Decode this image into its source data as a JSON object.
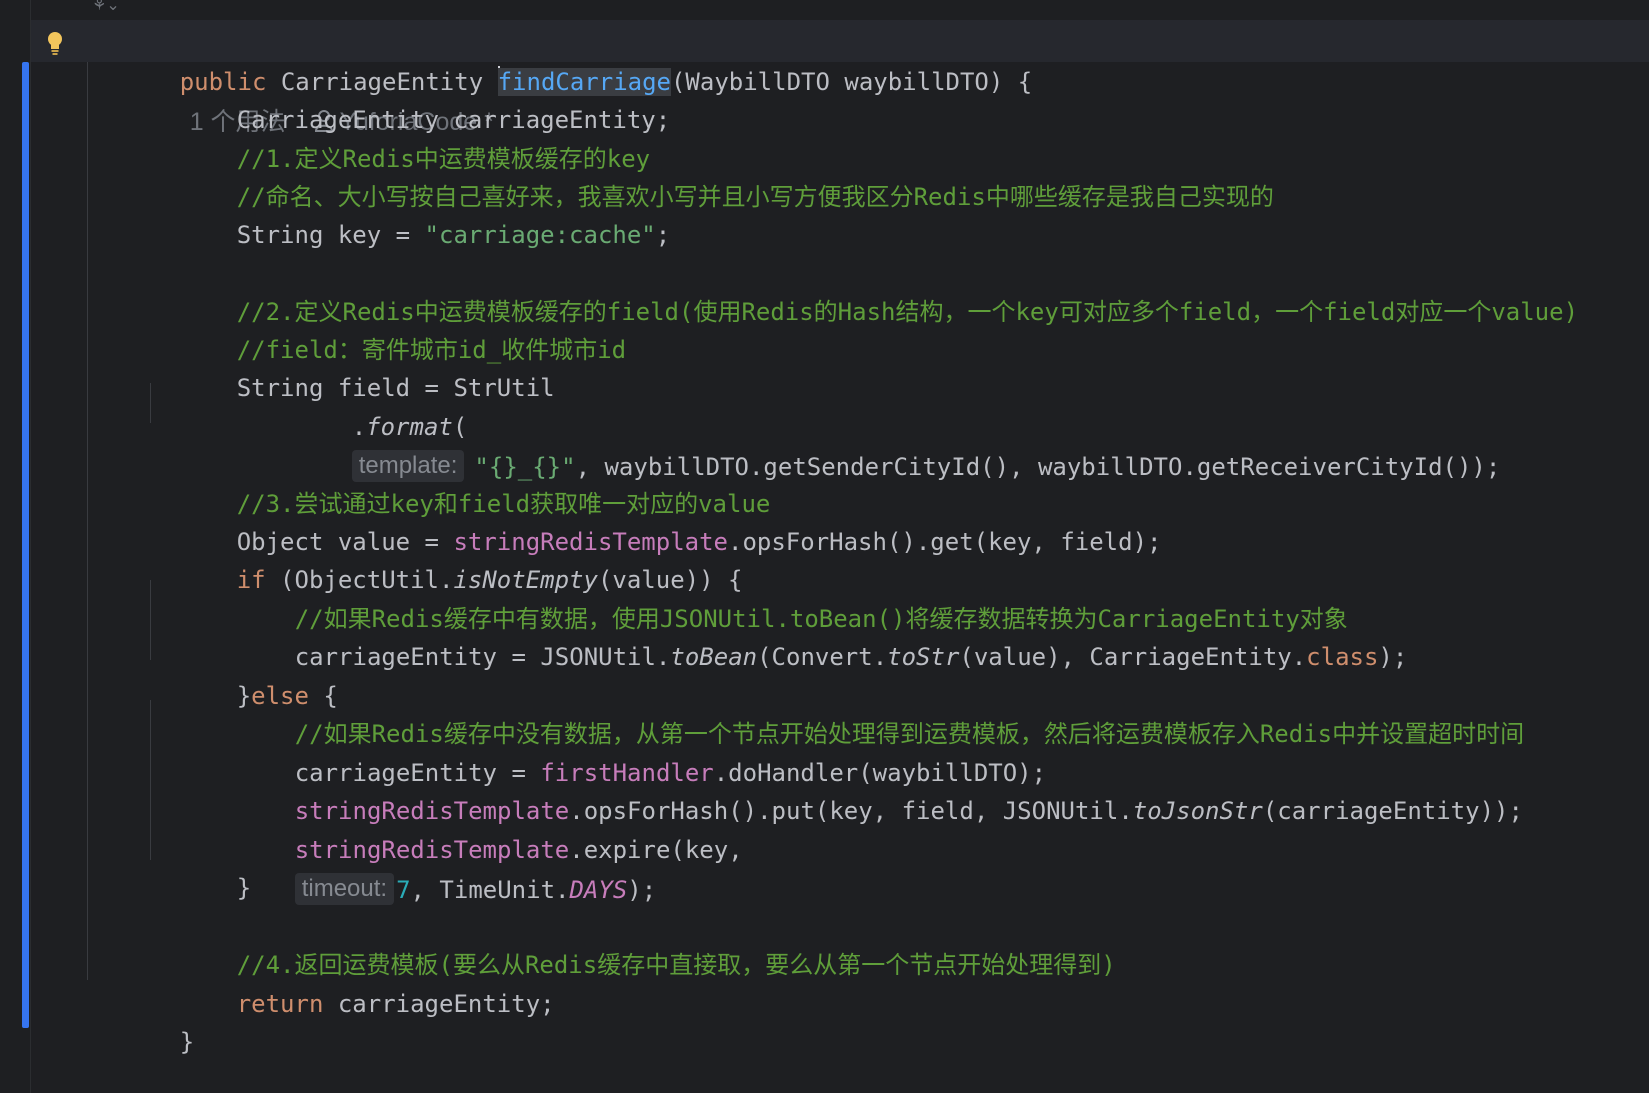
{
  "editor": {
    "usage_count": "1 个用法",
    "author": "YuforiaCode *"
  },
  "code": {
    "l1_public": "public",
    "l1_type": " CarriageEntity ",
    "l1_method": "findCarriage",
    "l1_params": "(WaybillDTO waybillDTO) {",
    "l2": "CarriageEntity carriageEntity;",
    "l3_comment": "//1.定义Redis中运费模板缓存的key",
    "l4_comment": "//命名、大小写按自己喜好来，我喜欢小写并且小写方便我区分Redis中哪些缓存是我自己实现的",
    "l5_decl": "String key = ",
    "l5_str": "\"carriage:cache\"",
    "l5_end": ";",
    "l7_comment": "//2.定义Redis中运费模板缓存的field(使用Redis的Hash结构，一个key可对应多个field，一个field对应一个value)",
    "l8_comment": "//field：寄件城市id_收件城市id",
    "l9": "String field = StrUtil",
    "l10_dot": ".",
    "l10_format": "format",
    "l10_paren": "(",
    "l10_hint": "template:",
    "l10_str": "\"{}_{}\"",
    "l10_rest": ", waybillDTO.getSenderCityId(), waybillDTO.getReceiverCityId());",
    "l12_comment": "//3.尝试通过key和field获取唯一对应的value",
    "l13_decl": "Object value = ",
    "l13_field": "stringRedisTemplate",
    "l13_rest": ".opsForHash().get(key, field);",
    "l14_if": "if",
    "l14_a": " (ObjectUtil.",
    "l14_method": "isNotEmpty",
    "l14_b": "(value)) {",
    "l15_comment": "//如果Redis缓存中有数据，使用JSONUtil.toBean()将缓存数据转换为CarriageEntity对象",
    "l16_a": "carriageEntity = JSONUtil.",
    "l16_tobean": "toBean",
    "l16_b": "(Convert.",
    "l16_tostr": "toStr",
    "l16_c": "(value), CarriageEntity.",
    "l16_class": "class",
    "l16_d": ");",
    "l17_brace": "}",
    "l17_else": "else",
    "l17_b": " {",
    "l18_comment": "//如果Redis缓存中没有数据，从第一个节点开始处理得到运费模板，然后将运费模板存入Redis中并设置超时时间",
    "l19_a": "carriageEntity = ",
    "l19_field": "firstHandler",
    "l19_b": ".doHandler(waybillDTO);",
    "l20_field": "stringRedisTemplate",
    "l20_a": ".opsForHash().put(key, field, JSONUtil.",
    "l20_method": "toJsonStr",
    "l20_b": "(carriageEntity));",
    "l21_field": "stringRedisTemplate",
    "l21_a": ".expire(key, ",
    "l21_hint": "timeout:",
    "l21_num": "7",
    "l21_b": ", TimeUnit.",
    "l21_const": "DAYS",
    "l21_c": ");",
    "l22": "}",
    "l24_comment": "//4.返回运费模板(要么从Redis缓存中直接取，要么从第一个节点开始处理得到)",
    "l25_return": "return",
    "l25_rest": " carriageEntity;",
    "l26": "}"
  }
}
